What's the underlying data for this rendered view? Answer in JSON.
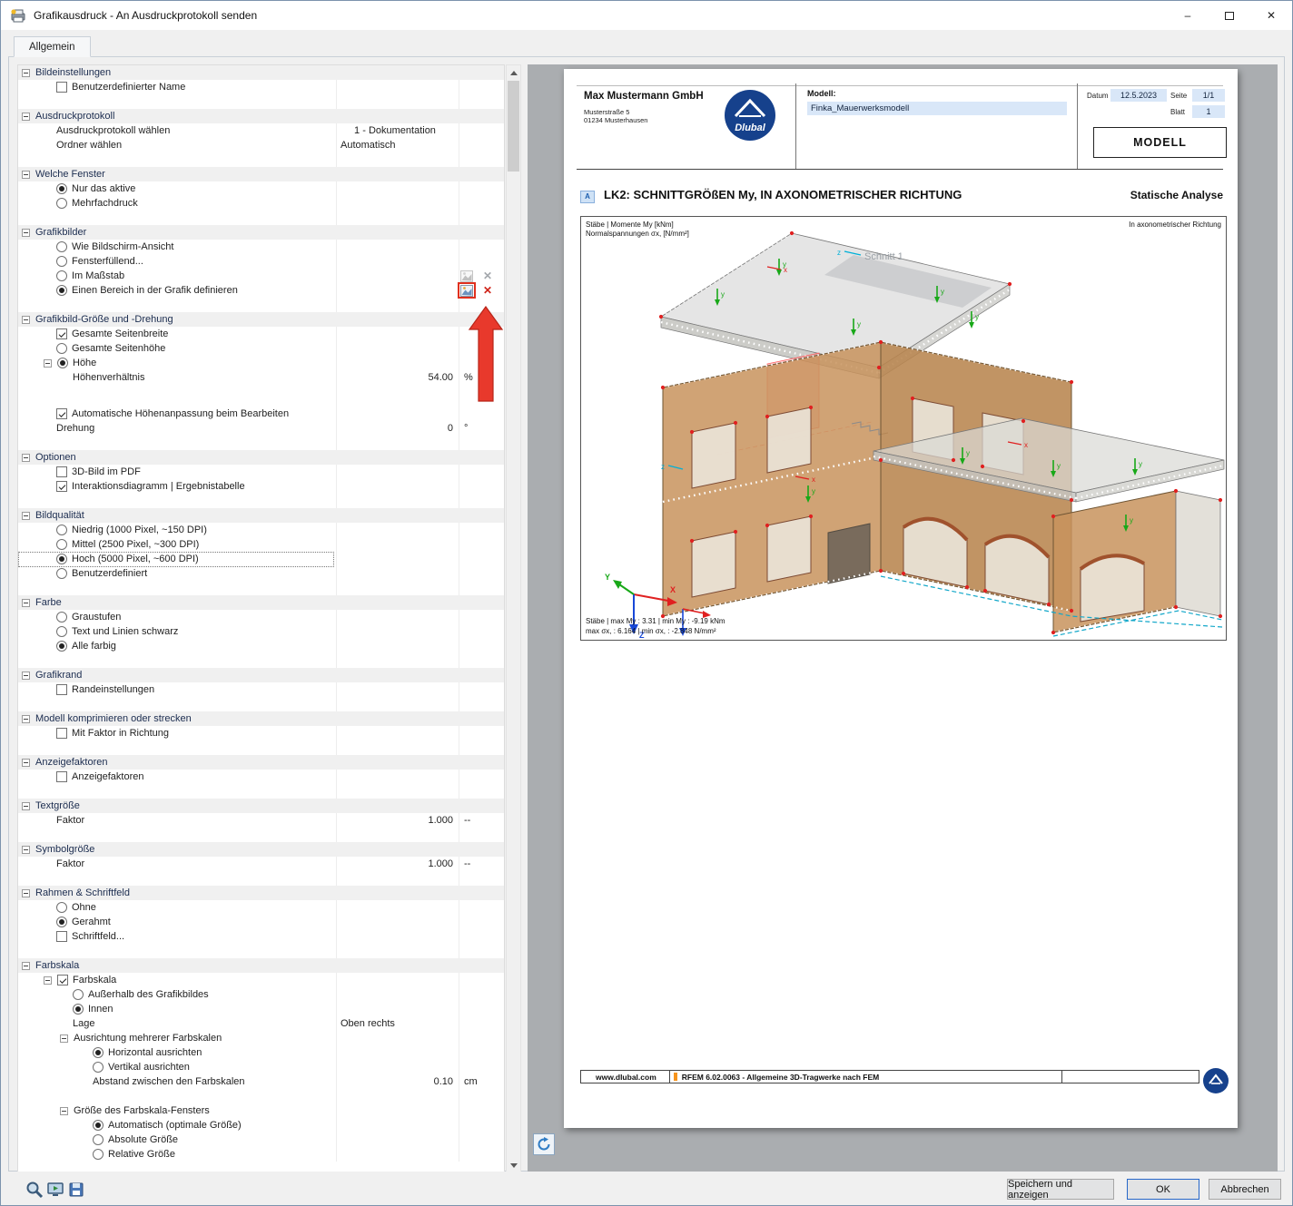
{
  "window": {
    "title": "Grafikausdruck - An Ausdruckprotokoll senden",
    "tab": "Allgemein"
  },
  "glyphs": {
    "minimize": "–",
    "close": "✕",
    "clear": "✕"
  },
  "settings": {
    "rows": [
      {
        "t": "section",
        "label": "Bildeinstellungen"
      },
      {
        "t": "check",
        "label": "Benutzerdefinierter Name",
        "c": false
      },
      {
        "t": "gap"
      },
      {
        "t": "section",
        "label": "Ausdruckprotokoll"
      },
      {
        "t": "valtext",
        "label": "Ausdruckprotokoll wählen",
        "value": "1 - Dokumentation",
        "va": "c"
      },
      {
        "t": "valtext",
        "label": "Ordner wählen",
        "value": "Automatisch",
        "va": "l"
      },
      {
        "t": "gap"
      },
      {
        "t": "section",
        "label": "Welche Fenster"
      },
      {
        "t": "radio",
        "label": "Nur das aktive",
        "c": true
      },
      {
        "t": "radio",
        "label": "Mehrfachdruck",
        "c": false
      },
      {
        "t": "gap"
      },
      {
        "t": "section",
        "label": "Grafikbilder"
      },
      {
        "t": "radio",
        "label": "Wie Bildschirm-Ansicht",
        "c": false
      },
      {
        "t": "radio",
        "label": "Fensterfüllend...",
        "c": false
      },
      {
        "t": "radio",
        "label": "Im Maßstab",
        "c": false,
        "icons": "gray"
      },
      {
        "t": "radio",
        "label": "Einen Bereich in der Grafik definieren",
        "c": true,
        "icons": "active"
      },
      {
        "t": "gap"
      },
      {
        "t": "section",
        "label": "Grafikbild-Größe und -Drehung"
      },
      {
        "t": "check",
        "label": "Gesamte Seitenbreite",
        "c": true
      },
      {
        "t": "radio",
        "label": "Gesamte Seitenhöhe",
        "c": false
      },
      {
        "t": "radio",
        "label": "Höhe",
        "c": true,
        "tree": true
      },
      {
        "t": "value",
        "label": "Höhenverhältnis",
        "value": "54.00",
        "unit": "%",
        "i": 2
      },
      {
        "t": "gap24"
      },
      {
        "t": "check",
        "label": "Automatische Höhenanpassung beim Bearbeiten",
        "c": true
      },
      {
        "t": "value",
        "label": "Drehung",
        "value": "0",
        "unit": "°",
        "i": 1
      },
      {
        "t": "gap"
      },
      {
        "t": "section",
        "label": "Optionen"
      },
      {
        "t": "check",
        "label": "3D-Bild im PDF",
        "c": false
      },
      {
        "t": "check",
        "label": "Interaktionsdiagramm | Ergebnistabelle",
        "c": true
      },
      {
        "t": "gap"
      },
      {
        "t": "section",
        "label": "Bildqualität"
      },
      {
        "t": "radio",
        "label": "Niedrig (1000 Pixel, ~150 DPI)",
        "c": false
      },
      {
        "t": "radio",
        "label": "Mittel (2500 Pixel, ~300 DPI)",
        "c": false
      },
      {
        "t": "radio",
        "label": "Hoch (5000 Pixel, ~600 DPI)",
        "c": true,
        "focus": true
      },
      {
        "t": "radio",
        "label": "Benutzerdefiniert",
        "c": false
      },
      {
        "t": "gap"
      },
      {
        "t": "section",
        "label": "Farbe"
      },
      {
        "t": "radio",
        "label": "Graustufen",
        "c": false
      },
      {
        "t": "radio",
        "label": "Text und Linien schwarz",
        "c": false
      },
      {
        "t": "radio",
        "label": "Alle farbig",
        "c": true
      },
      {
        "t": "gap"
      },
      {
        "t": "section",
        "label": "Grafikrand"
      },
      {
        "t": "check",
        "label": "Randeinstellungen",
        "c": false
      },
      {
        "t": "gap"
      },
      {
        "t": "section",
        "label": "Modell komprimieren oder strecken"
      },
      {
        "t": "check",
        "label": "Mit Faktor in Richtung",
        "c": false
      },
      {
        "t": "gap"
      },
      {
        "t": "section",
        "label": "Anzeigefaktoren"
      },
      {
        "t": "check",
        "label": "Anzeigefaktoren",
        "c": false
      },
      {
        "t": "gap"
      },
      {
        "t": "section",
        "label": "Textgröße"
      },
      {
        "t": "value",
        "label": "Faktor",
        "value": "1.000",
        "unit": "--",
        "i": 1
      },
      {
        "t": "gap"
      },
      {
        "t": "section",
        "label": "Symbolgröße"
      },
      {
        "t": "value",
        "label": "Faktor",
        "value": "1.000",
        "unit": "--",
        "i": 1
      },
      {
        "t": "gap"
      },
      {
        "t": "section",
        "label": "Rahmen & Schriftfeld"
      },
      {
        "t": "radio",
        "label": "Ohne",
        "c": false
      },
      {
        "t": "radio",
        "label": "Gerahmt",
        "c": true
      },
      {
        "t": "check",
        "label": "Schriftfeld...",
        "c": false
      },
      {
        "t": "gap"
      },
      {
        "t": "section",
        "label": "Farbskala"
      },
      {
        "t": "check",
        "label": "Farbskala",
        "c": true,
        "tree": true
      },
      {
        "t": "radio",
        "label": "Außerhalb des Grafikbildes",
        "c": false,
        "i": 2
      },
      {
        "t": "radio",
        "label": "Innen",
        "c": true,
        "i": 2
      },
      {
        "t": "valtext",
        "label": "Lage",
        "value": "Oben rechts",
        "va": "l",
        "i": 2
      },
      {
        "t": "sub",
        "label": "Ausrichtung mehrerer Farbskalen"
      },
      {
        "t": "radio",
        "label": "Horizontal ausrichten",
        "c": true,
        "i": 3
      },
      {
        "t": "radio",
        "label": "Vertikal ausrichten",
        "c": false,
        "i": 3
      },
      {
        "t": "value",
        "label": "Abstand zwischen den Farbskalen",
        "value": "0.10",
        "unit": "cm",
        "i": 3
      },
      {
        "t": "gap"
      },
      {
        "t": "sub",
        "label": "Größe des Farbskala-Fensters"
      },
      {
        "t": "radio",
        "label": "Automatisch (optimale Größe)",
        "c": true,
        "i": 3
      },
      {
        "t": "radio",
        "label": "Absolute Größe",
        "c": false,
        "i": 3
      },
      {
        "t": "radio",
        "label": "Relative Größe",
        "c": false,
        "i": 3
      }
    ]
  },
  "preview": {
    "company": {
      "name": "Max Mustermann GmbH",
      "street": "Musterstraße 5",
      "city": "01234 Musterhausen"
    },
    "logo_text": "Dlubal",
    "model": {
      "label": "Modell:",
      "value": "Finka_Mauerwerksmodell"
    },
    "meta": {
      "datum_label": "Datum",
      "datum": "12.5.2023",
      "seite_label": "Seite",
      "seite": "1/1",
      "blatt_label": "Blatt",
      "blatt": "1"
    },
    "modell_box": "MODELL",
    "section": {
      "marker": "A",
      "title": "LK2: SCHNITTGRÖßEN My, IN AXONOMETRISCHER RICHTUNG",
      "right": "Statische Analyse"
    },
    "graphic": {
      "top_left_1": "Stäbe | Momente My [kNm]",
      "top_left_2": "Normalspannungen σx, [N/mm²]",
      "top_right": "In axonometrischer Richtung",
      "schnitt": "Schnitt 1",
      "result_1": "Stäbe | max My : 3.31 | min My : -9.19 kNm",
      "result_2": "max σx, : 6.164 | min σx, : -2.848 N/mm²",
      "axis": {
        "x": "x",
        "y": "y",
        "z": "z",
        "bx": "X",
        "by": "Y",
        "bz": "Z"
      }
    },
    "footer": {
      "site": "www.dlubal.com",
      "app": "RFEM 6.02.0063 - Allgemeine 3D-Tragwerke nach FEM"
    }
  },
  "buttons": {
    "save_show": "Speichern und anzeigen",
    "ok": "OK",
    "cancel": "Abbrechen"
  }
}
